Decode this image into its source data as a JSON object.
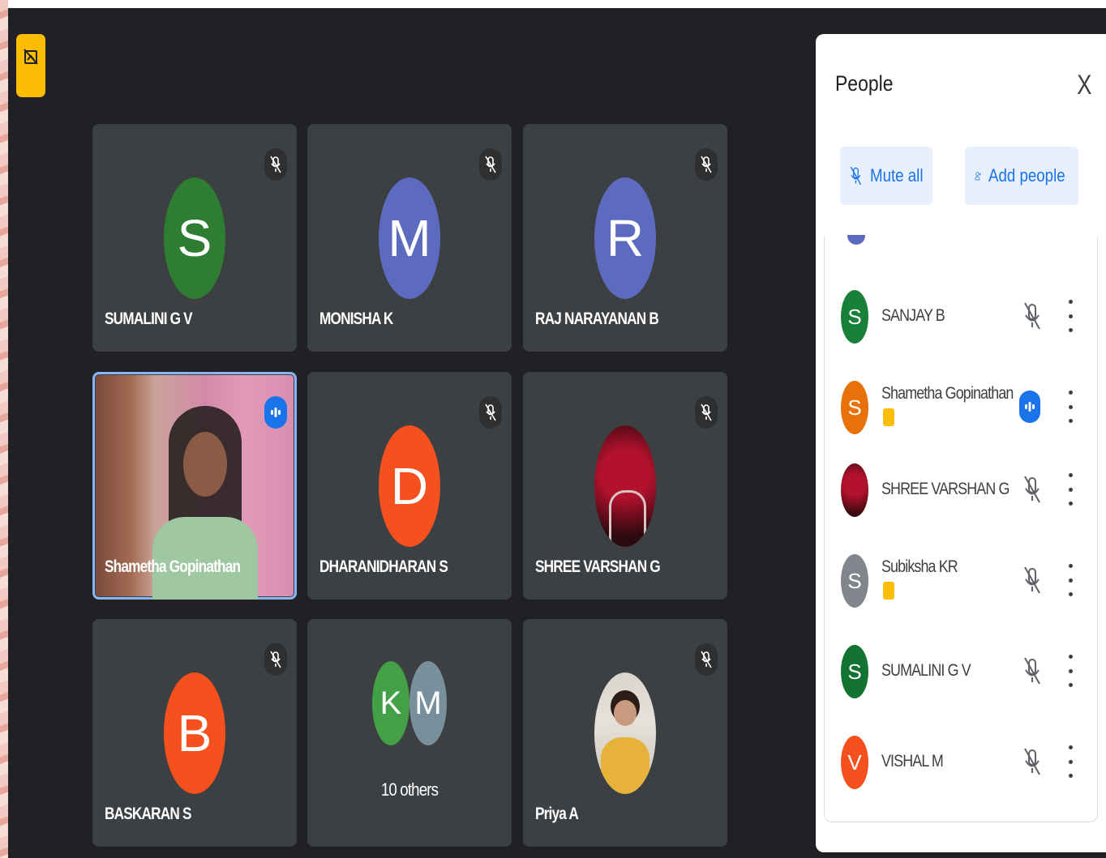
{
  "panel": {
    "title": "People",
    "close_label": "X",
    "mute_all_label": "Mute all",
    "add_people_label": "Add people",
    "participants": [
      {
        "name": "SANJAY B",
        "initial": "S",
        "color": "#188038",
        "status": "muted"
      },
      {
        "name": "Shametha Gopinathan",
        "initial": "S",
        "color": "#e8710a",
        "status": "speaking"
      },
      {
        "name": "SHREE VARSHAN G",
        "initial": "",
        "color": "#8b1a2b",
        "status": "muted"
      },
      {
        "name": "Subiksha KR",
        "initial": "S",
        "color": "#80868b",
        "status": "muted"
      },
      {
        "name": "SUMALINI G V",
        "initial": "S",
        "color": "#137333",
        "status": "muted"
      },
      {
        "name": "VISHAL M",
        "initial": "V",
        "color": "#f4511e",
        "status": "muted"
      }
    ]
  },
  "tiles": [
    {
      "name": "SUMALINI G V",
      "initial": "S",
      "color": "#2e7d32"
    },
    {
      "name": "MONISHA K",
      "initial": "M",
      "color": "#5c6bc0"
    },
    {
      "name": "RAJ NARAYANAN B",
      "initial": "R",
      "color": "#5c6bc0"
    },
    {
      "name": "Shametha Gopinathan",
      "initial": "",
      "color": ""
    },
    {
      "name": "DHARANIDHARAN S",
      "initial": "D",
      "color": "#f4511e"
    },
    {
      "name": "SHREE VARSHAN G",
      "initial": "",
      "color": ""
    },
    {
      "name": "BASKARAN S",
      "initial": "B",
      "color": "#f4511e"
    },
    {
      "name": "10 others",
      "initials": [
        "K",
        "M"
      ],
      "colors": [
        "#43a047",
        "#78909c"
      ]
    },
    {
      "name": "Priya A",
      "initial": "",
      "color": ""
    }
  ]
}
